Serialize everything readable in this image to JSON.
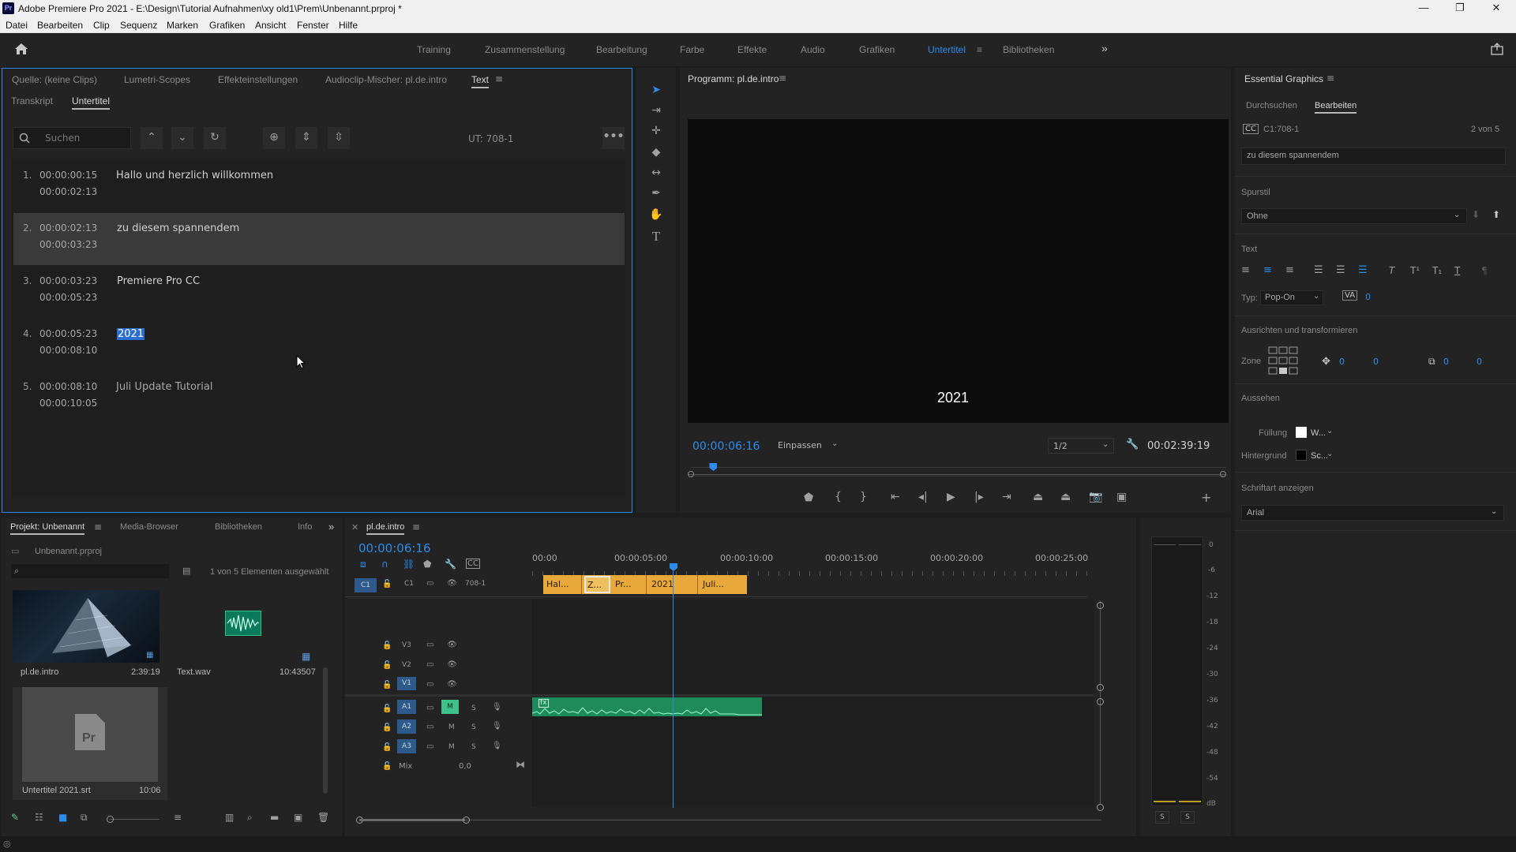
{
  "window": {
    "title": "Adobe Premiere Pro 2021 - E:\\Design\\Tutorial Aufnahmen\\xy old1\\Prem\\Unbenannt.prproj *",
    "app_icon": "Pr",
    "controls": {
      "minimize": "—",
      "maximize": "❐",
      "close": "✕"
    }
  },
  "menu": [
    "Datei",
    "Bearbeiten",
    "Clip",
    "Sequenz",
    "Marken",
    "Grafiken",
    "Ansicht",
    "Fenster",
    "Hilfe"
  ],
  "workspaces": {
    "items": [
      "Training",
      "Zusammenstellung",
      "Bearbeitung",
      "Farbe",
      "Effekte",
      "Audio",
      "Grafiken",
      "Untertitel",
      "Bibliotheken"
    ],
    "active": "Untertitel",
    "more": "»"
  },
  "source_panel": {
    "tabs": [
      "Quelle: (keine Clips)",
      "Lumetri-Scopes",
      "Effekteinstellungen",
      "Audioclip-Mischer: pl.de.intro",
      "Text"
    ],
    "active_tab": "Text",
    "subtabs": [
      "Transkript",
      "Untertitel"
    ],
    "active_subtab": "Untertitel",
    "search_placeholder": "Suchen",
    "track_label": "UT: 708-1",
    "captions": [
      {
        "num": "1.",
        "in": "00:00:00:15",
        "out": "00:00:02:13",
        "text": "Hallo und herzlich willkommen"
      },
      {
        "num": "2.",
        "in": "00:00:02:13",
        "out": "00:00:03:23",
        "text": "zu diesem spannendem"
      },
      {
        "num": "3.",
        "in": "00:00:03:23",
        "out": "00:00:05:23",
        "text": "Premiere Pro CC"
      },
      {
        "num": "4.",
        "in": "00:00:05:23",
        "out": "00:00:08:10",
        "text": "2021"
      },
      {
        "num": "5.",
        "in": "00:00:08:10",
        "out": "00:00:10:05",
        "text": "Juli Update Tutorial"
      }
    ],
    "selected_index": 1
  },
  "program_monitor": {
    "title": "Programm: pl.de.intro",
    "caption_text": "2021",
    "timecode": "00:00:06:16",
    "fit": "Einpassen",
    "resolution": "1/2",
    "duration": "00:02:39:19",
    "playhead_fraction": 0.042
  },
  "essential_graphics": {
    "title": "Essential Graphics",
    "tabs": [
      "Durchsuchen",
      "Bearbeiten"
    ],
    "active_tab": "Bearbeiten",
    "caption_id": "C1:708-1",
    "count": "2 von 5",
    "text_value": "zu diesem spannendem",
    "section_style": "Spurstil",
    "style_value": "Ohne",
    "section_text": "Text",
    "type_label": "Typ:",
    "type_value": "Pop-On",
    "tracking_value": "0",
    "section_align": "Ausrichten und transformieren",
    "zone_label": "Zone",
    "pos_x": "0",
    "pos_y": "0",
    "scale_x": "0",
    "scale_y": "0",
    "section_appearance": "Aussehen",
    "fill_label": "Füllung",
    "fill_value": "W...",
    "bg_label": "Hintergrund",
    "bg_value": "Sc...",
    "font_section": "Schriftart anzeigen",
    "font_value": "Arial"
  },
  "project_panel": {
    "tabs": [
      "Projekt: Unbenannt",
      "Media-Browser",
      "Bibliotheken",
      "Info"
    ],
    "active_tab": "Projekt: Unbenannt",
    "more": "»",
    "file": "Unbenannt.prproj",
    "selection_info": "1 von 5 Elementen ausgewählt",
    "items": [
      {
        "name": "pl.de.intro",
        "duration": "2:39:19",
        "kind": "sequence"
      },
      {
        "name": "Text.wav",
        "duration": "10:43507",
        "kind": "audio"
      },
      {
        "name": "Untertitel 2021.srt",
        "duration": "10:06",
        "kind": "captions"
      }
    ]
  },
  "timeline": {
    "tab": "pl.de.intro",
    "timecode": "00:00:06:16",
    "ruler": [
      "00:00",
      "00:00:05:00",
      "00:00:10:00",
      "00:00:15:00",
      "00:00:20:00",
      "00:00:25:00"
    ],
    "caption_track": {
      "label": "C1",
      "name": "708-1"
    },
    "caption_clips": [
      "Hal...",
      "Z...",
      "Pr...",
      "2021",
      "Juli..."
    ],
    "video_tracks": [
      "V3",
      "V2",
      "V1"
    ],
    "audio_tracks": [
      {
        "name": "A1",
        "m": "M",
        "s": "S"
      },
      {
        "name": "A2",
        "m": "M",
        "s": "S"
      },
      {
        "name": "A3",
        "m": "M",
        "s": "S"
      }
    ],
    "mix_label": "Mix",
    "mix_value": "0,0"
  },
  "audio_meter": {
    "db_labels": [
      "0",
      "-6",
      "-12",
      "-18",
      "-24",
      "-30",
      "-36",
      "-42",
      "-48",
      "-54",
      "dB"
    ],
    "solo": [
      "S",
      "S"
    ]
  },
  "colors": {
    "accent": "#2d8ceb",
    "caption_clip": "#e8a93a",
    "audio_clip": "#1f8a5a",
    "panel_bg": "#232323"
  }
}
